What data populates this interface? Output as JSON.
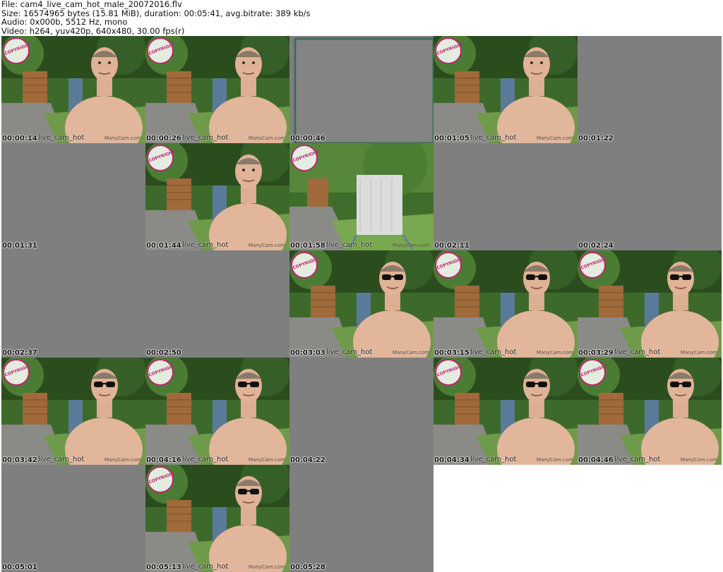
{
  "header": {
    "file": "File: cam4_live_cam_hot_male_20072016.flv",
    "size": "Size: 16574965 bytes (15.81 MiB), duration: 00:05:41, avg.bitrate: 389 kb/s",
    "audio": "Audio: 0x000b, 5512 Hz, mono",
    "video": "Video: h264, yuv420p, 640x480, 30.00 fps(r)"
  },
  "watermark": "live_cam_hot",
  "manycam": "ManyCam.com",
  "stamp_text": "COPYRIGHT",
  "tiles": [
    {
      "t": "00:00:14",
      "kind": "man"
    },
    {
      "t": "00:00:26",
      "kind": "man"
    },
    {
      "t": "00:00:46",
      "kind": "blank-frame"
    },
    {
      "t": "00:01:05",
      "kind": "man"
    },
    {
      "t": "00:01:22",
      "kind": "gray"
    },
    {
      "t": "00:01:31",
      "kind": "gray"
    },
    {
      "t": "00:01:44",
      "kind": "man"
    },
    {
      "t": "00:01:58",
      "kind": "chair"
    },
    {
      "t": "00:02:11",
      "kind": "gray"
    },
    {
      "t": "00:02:24",
      "kind": "gray"
    },
    {
      "t": "00:02:37",
      "kind": "gray"
    },
    {
      "t": "00:02:50",
      "kind": "gray"
    },
    {
      "t": "00:03:03",
      "kind": "man-glasses"
    },
    {
      "t": "00:03:15",
      "kind": "man-glasses"
    },
    {
      "t": "00:03:29",
      "kind": "man-glasses"
    },
    {
      "t": "00:03:42",
      "kind": "man-glasses"
    },
    {
      "t": "00:04:16",
      "kind": "man-glasses"
    },
    {
      "t": "00:04:22",
      "kind": "gray"
    },
    {
      "t": "00:04:34",
      "kind": "man-glasses"
    },
    {
      "t": "00:04:46",
      "kind": "man-glasses"
    },
    {
      "t": "00:05:01",
      "kind": "gray"
    },
    {
      "t": "00:05:13",
      "kind": "man-glasses"
    },
    {
      "t": "00:05:28",
      "kind": "gray"
    }
  ],
  "colors": {
    "gray_tile": "#7f7f7f",
    "stamp": "#c0246e",
    "hedge": "#2f5a23",
    "skin": "#d9a98c"
  }
}
